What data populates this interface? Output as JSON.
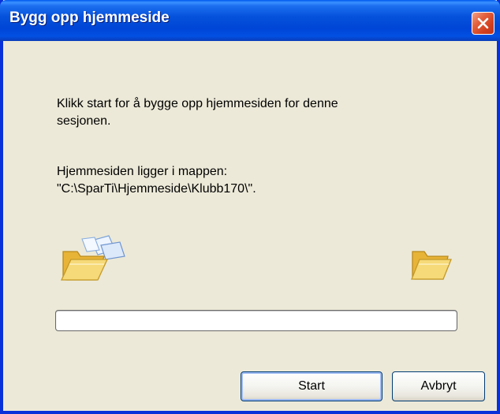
{
  "window": {
    "title": "Bygg opp hjemmeside",
    "close_icon": "close-icon"
  },
  "message": {
    "line1": "Klikk start for å bygge opp hjemmesiden for denne",
    "line2": "sesjonen.",
    "line3": "Hjemmesiden ligger i mappen:",
    "line4": "\"C:\\SparTi\\Hjemmeside\\Klubb170\\\"."
  },
  "animation": {
    "source_icon": "open-folder-with-flying-papers-icon",
    "target_icon": "open-folder-icon"
  },
  "progress": {
    "value_fraction": 0
  },
  "buttons": {
    "start_label": "Start",
    "cancel_label": "Avbryt"
  },
  "colors": {
    "titlebar": "#0054e3",
    "dialog_background": "#ece9d8",
    "close_button": "#e0593a",
    "folder": "#f5d77a"
  }
}
